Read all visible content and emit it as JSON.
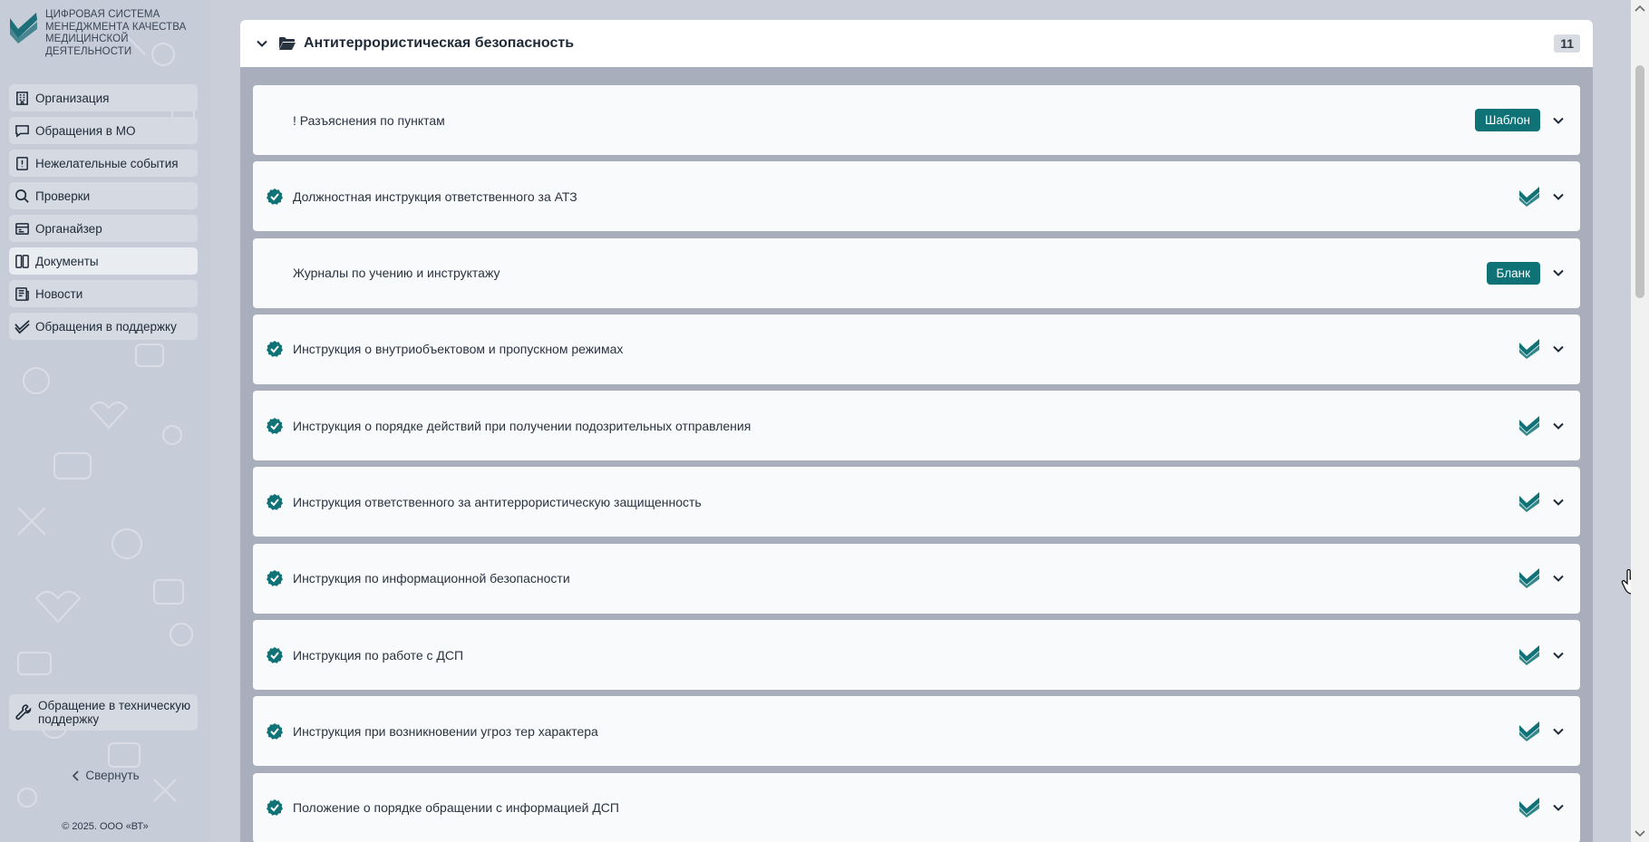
{
  "brand": {
    "lines": [
      "ЦИФРОВАЯ СИСТЕМА",
      "МЕНЕДЖМЕНТА КАЧЕСТВА",
      "МЕДИЦИНСКОЙ",
      "ДЕЯТЕЛЬНОСТИ"
    ]
  },
  "sidebar": {
    "items": [
      {
        "label": "Организация",
        "icon": "building-icon"
      },
      {
        "label": "Обращения в МО",
        "icon": "chat-icon"
      },
      {
        "label": "Нежелательные события",
        "icon": "alert-book-icon"
      },
      {
        "label": "Проверки",
        "icon": "search-icon"
      },
      {
        "label": "Органайзер",
        "icon": "organizer-icon"
      },
      {
        "label": "Документы",
        "icon": "documents-icon",
        "active": true
      },
      {
        "label": "Новости",
        "icon": "news-icon"
      },
      {
        "label": "Обращения в поддержку",
        "icon": "support-check-icon"
      }
    ],
    "support_label_1": "Обращение в техническую",
    "support_label_2": "поддержку",
    "collapse_label": "Свернуть",
    "copyright": "© 2025. ООО «ВТ»"
  },
  "section": {
    "title": "Антитеррористическая безопасность",
    "count": "11"
  },
  "documents": [
    {
      "title": "! Разъяснения по пунктам",
      "tag": "Шаблон",
      "approved": false
    },
    {
      "title": "Должностная инструкция ответственного за АТЗ",
      "tag": "",
      "approved": true
    },
    {
      "title": "Журналы по учению и инструктажу",
      "tag": "Бланк",
      "approved": false
    },
    {
      "title": "Инструкция о внутриобъектовом и пропускном режимах",
      "tag": "",
      "approved": true
    },
    {
      "title": "Инструкция о порядке действий при получении подозрительных отправления",
      "tag": "",
      "approved": true
    },
    {
      "title": "Инструкция ответственного за антитеррористическую защищенность",
      "tag": "",
      "approved": true
    },
    {
      "title": "Инструкция по информационной безопасности",
      "tag": "",
      "approved": true
    },
    {
      "title": "Инструкция по работе с ДСП",
      "tag": "",
      "approved": true
    },
    {
      "title": "Инструкция при возникновении угроз тер характера",
      "tag": "",
      "approved": true
    },
    {
      "title": "Положение о порядке обращении с информацией ДСП",
      "tag": "",
      "approved": true
    }
  ],
  "colors": {
    "accent": "#0f7277",
    "brand": "#1c6f78"
  }
}
